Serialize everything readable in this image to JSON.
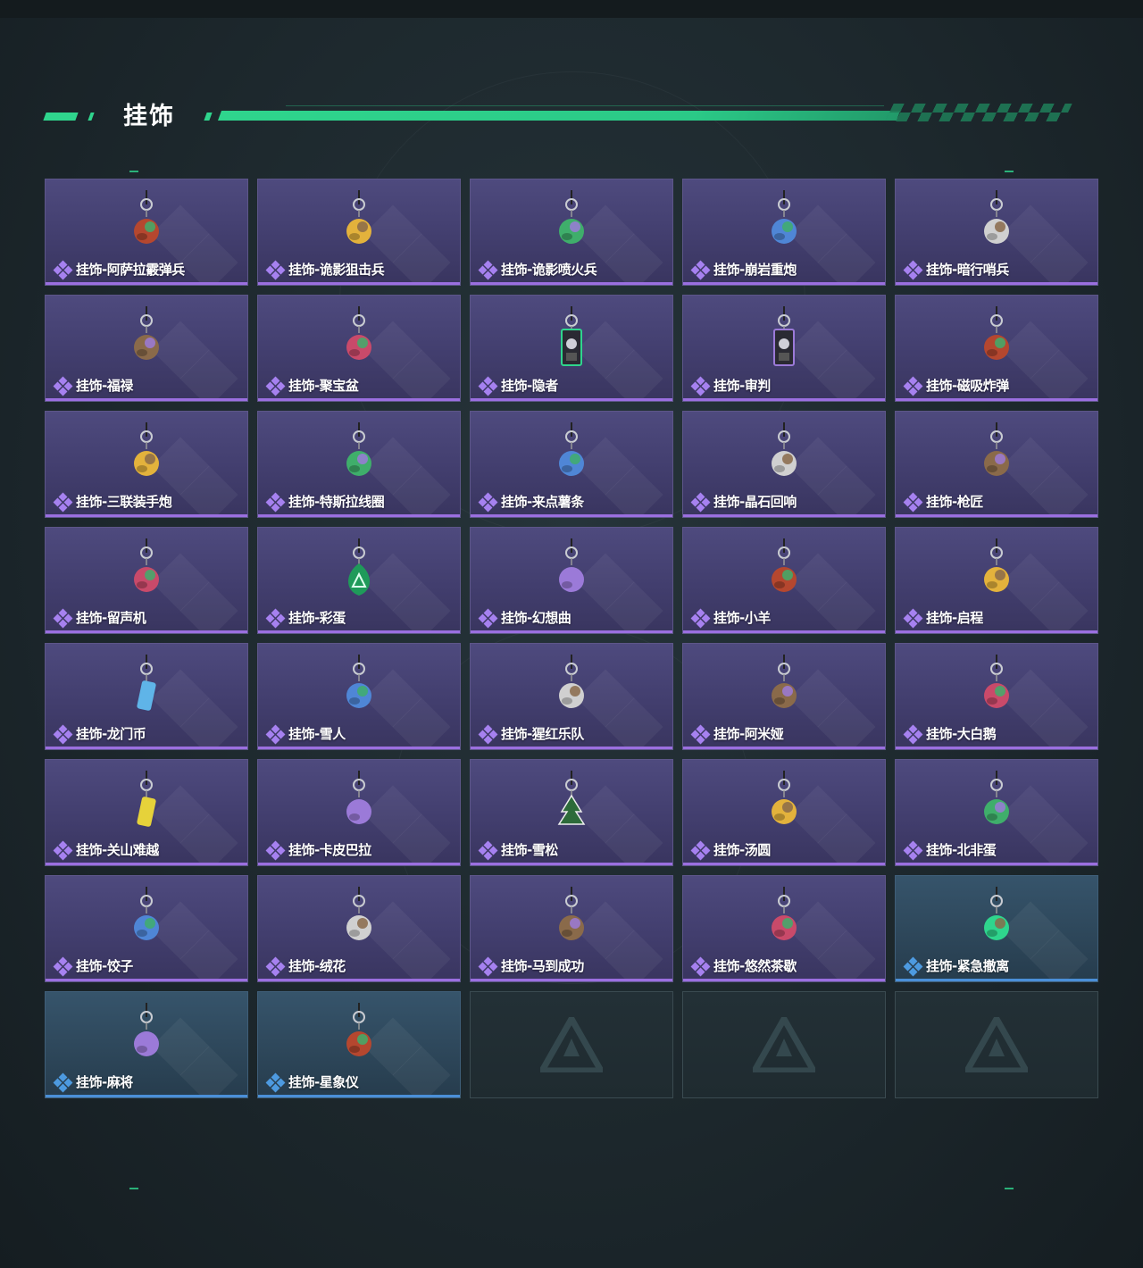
{
  "section": {
    "title": "挂饰"
  },
  "items": [
    {
      "name": "挂饰-阿萨拉霰弹兵",
      "rarity": "purple",
      "icon": "soldier-charm"
    },
    {
      "name": "挂饰-诡影狙击兵",
      "rarity": "purple",
      "icon": "penguin-sniper-charm"
    },
    {
      "name": "挂饰-诡影喷火兵",
      "rarity": "purple",
      "icon": "flamethrower-charm"
    },
    {
      "name": "挂饰-崩岩重炮",
      "rarity": "purple",
      "icon": "heavy-gunner-charm"
    },
    {
      "name": "挂饰-暗行哨兵",
      "rarity": "purple",
      "icon": "sentinel-charm"
    },
    {
      "name": "挂饰-福禄",
      "rarity": "purple",
      "icon": "gourd-charm"
    },
    {
      "name": "挂饰-聚宝盆",
      "rarity": "purple",
      "icon": "treasure-bowl-charm"
    },
    {
      "name": "挂饰-隐者",
      "rarity": "purple",
      "icon": "card-charm"
    },
    {
      "name": "挂饰-审判",
      "rarity": "purple",
      "icon": "card-charm"
    },
    {
      "name": "挂饰-磁吸炸弹",
      "rarity": "purple",
      "icon": "bomb-charm"
    },
    {
      "name": "挂饰-三联装手炮",
      "rarity": "purple",
      "icon": "hand-cannon-charm"
    },
    {
      "name": "挂饰-特斯拉线圈",
      "rarity": "purple",
      "icon": "tesla-coil-charm"
    },
    {
      "name": "挂饰-来点薯条",
      "rarity": "purple",
      "icon": "fries-charm"
    },
    {
      "name": "挂饰-晶石回响",
      "rarity": "purple",
      "icon": "crystal-charm"
    },
    {
      "name": "挂饰-枪匠",
      "rarity": "purple",
      "icon": "gunsmith-charm"
    },
    {
      "name": "挂饰-留声机",
      "rarity": "purple",
      "icon": "gramophone-charm"
    },
    {
      "name": "挂饰-彩蛋",
      "rarity": "purple",
      "icon": "easter-egg-charm"
    },
    {
      "name": "挂饰-幻想曲",
      "rarity": "purple",
      "icon": "fantasia-charm"
    },
    {
      "name": "挂饰-小羊",
      "rarity": "purple",
      "icon": "lamb-charm"
    },
    {
      "name": "挂饰-启程",
      "rarity": "purple",
      "icon": "departure-charm"
    },
    {
      "name": "挂饰-龙门币",
      "rarity": "purple",
      "icon": "coin-charm"
    },
    {
      "name": "挂饰-雪人",
      "rarity": "purple",
      "icon": "snowman-charm"
    },
    {
      "name": "挂饰-猩红乐队",
      "rarity": "purple",
      "icon": "horn-charm"
    },
    {
      "name": "挂饰-阿米娅",
      "rarity": "purple",
      "icon": "amiya-charm"
    },
    {
      "name": "挂饰-大白鹅",
      "rarity": "purple",
      "icon": "goose-charm"
    },
    {
      "name": "挂饰-关山难越",
      "rarity": "purple",
      "icon": "scroll-charm"
    },
    {
      "name": "挂饰-卡皮巴拉",
      "rarity": "purple",
      "icon": "capybara-charm"
    },
    {
      "name": "挂饰-雪松",
      "rarity": "purple",
      "icon": "pine-tree-charm"
    },
    {
      "name": "挂饰-汤圆",
      "rarity": "purple",
      "icon": "rice-ball-charm"
    },
    {
      "name": "挂饰-北非蛋",
      "rarity": "purple",
      "icon": "shakshuka-charm"
    },
    {
      "name": "挂饰-饺子",
      "rarity": "purple",
      "icon": "dumpling-charm"
    },
    {
      "name": "挂饰-绒花",
      "rarity": "purple",
      "icon": "flower-charm"
    },
    {
      "name": "挂饰-马到成功",
      "rarity": "purple",
      "icon": "horse-charm"
    },
    {
      "name": "挂饰-悠然茶歇",
      "rarity": "purple",
      "icon": "cupcake-charm"
    },
    {
      "name": "挂饰-紧急撤离",
      "rarity": "blue",
      "icon": "evac-charm"
    },
    {
      "name": "挂饰-麻将",
      "rarity": "blue",
      "icon": "mahjong-charm"
    },
    {
      "name": "挂饰-星象仪",
      "rarity": "blue",
      "icon": "astrolabe-charm"
    }
  ],
  "empty_slots": 3,
  "colors": {
    "accent": "#2fd58d",
    "purple_card": "#4e4a7e",
    "purple_rarity": "#9b6fe0",
    "blue_card": "#36546b",
    "blue_rarity": "#4a8fd8"
  }
}
